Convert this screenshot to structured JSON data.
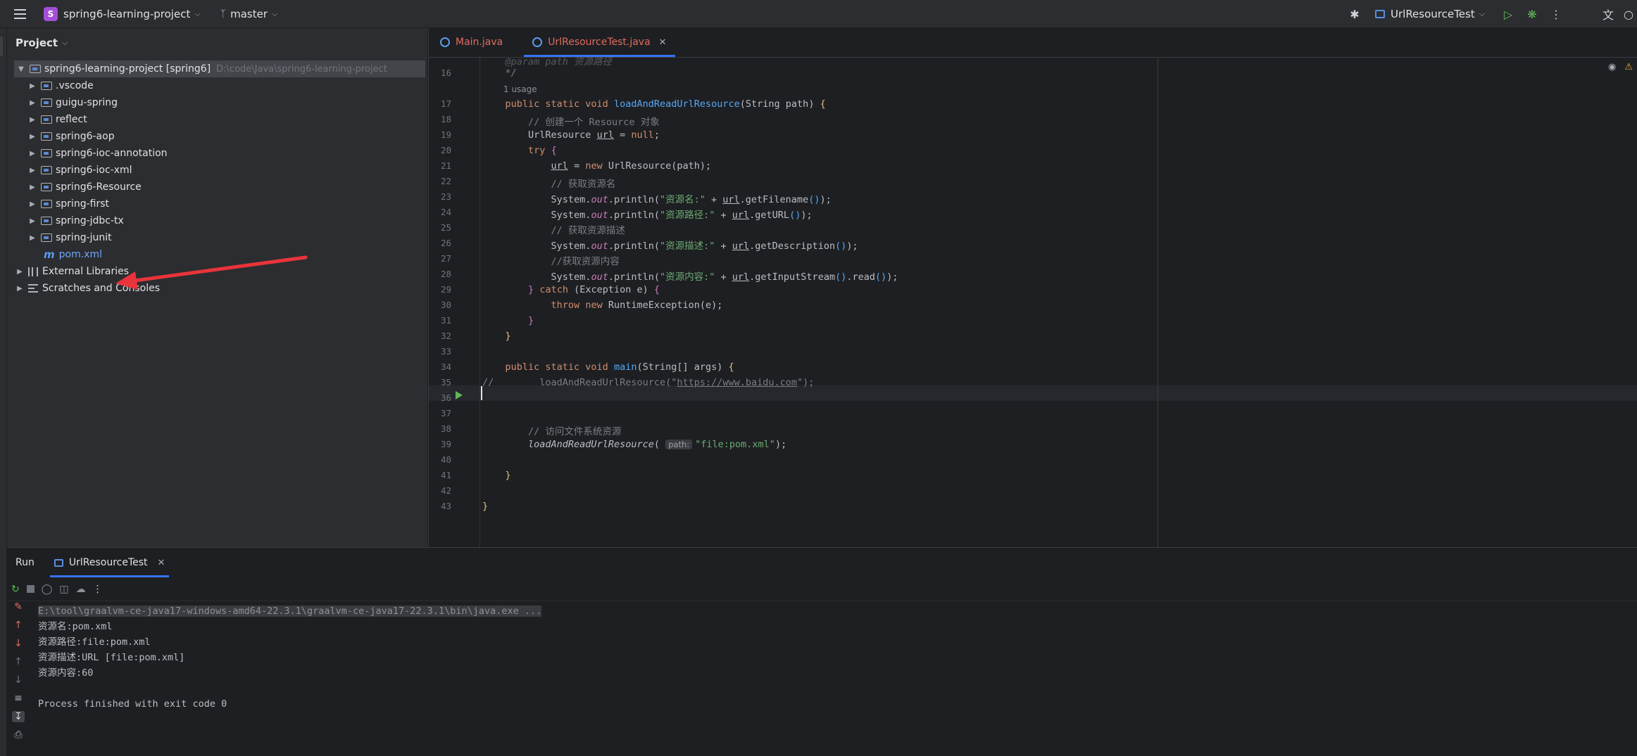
{
  "titlebar": {
    "project_badge": "S",
    "project_name": "spring6-learning-project",
    "branch": "master",
    "run_config": "UrlResourceTest"
  },
  "project_panel": {
    "title": "Project",
    "root": {
      "name": "spring6-learning-project [spring6]",
      "path": "D:\\code\\Java\\spring6-learning-project"
    },
    "folders": [
      ".vscode",
      "guigu-spring",
      "reflect",
      "spring6-aop",
      "spring6-ioc-annotation",
      "spring6-ioc-xml",
      "spring6-Resource",
      "spring-first",
      "spring-jdbc-tx",
      "spring-junit"
    ],
    "pom": "pom.xml",
    "external_libraries": "External Libraries",
    "scratches": "Scratches and Consoles"
  },
  "editor": {
    "tabs": [
      {
        "label": "Main.java"
      },
      {
        "label": "UrlResourceTest.java"
      }
    ],
    "usage_hint": "1 usage",
    "param_hint": "path:",
    "line_numbers": [
      "16",
      "17",
      "18",
      "19",
      "20",
      "21",
      "22",
      "23",
      "24",
      "25",
      "26",
      "27",
      "28",
      "29",
      "30",
      "31",
      "32",
      "33",
      "34",
      "35",
      "36",
      "37",
      "38",
      "39",
      "40",
      "41",
      "42",
      "43"
    ]
  },
  "run_panel": {
    "title": "Run",
    "tab": "UrlResourceTest",
    "console": [
      "E:\\tool\\graalvm-ce-java17-windows-amd64-22.3.1\\graalvm-ce-java17-22.3.1\\bin\\java.exe ...",
      "资源名:pom.xml",
      "资源路径:file:pom.xml",
      "资源描述:URL [file:pom.xml]",
      "资源内容:60",
      "",
      "Process finished with exit code 0"
    ]
  },
  "colors": {
    "accent": "#3574f0",
    "run": "#5fb857",
    "annotation_arrow": "#e8343a"
  }
}
